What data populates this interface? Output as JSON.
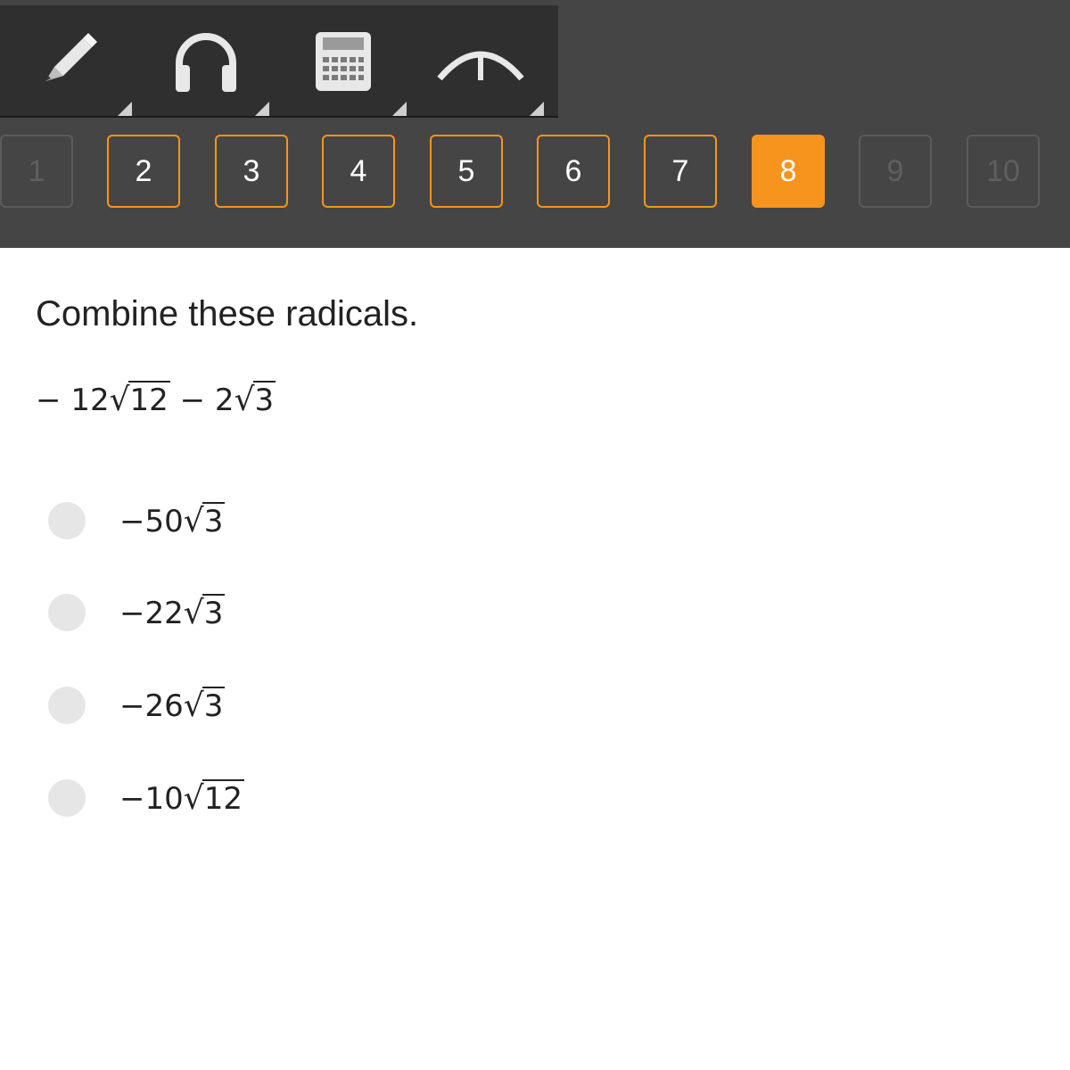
{
  "toolbar": {
    "tools": [
      {
        "name": "pencil-icon"
      },
      {
        "name": "headphones-icon"
      },
      {
        "name": "calculator-icon"
      },
      {
        "name": "graph-icon"
      }
    ]
  },
  "question_nav": {
    "items": [
      {
        "label": "1",
        "state": "disabled"
      },
      {
        "label": "2",
        "state": "visited"
      },
      {
        "label": "3",
        "state": "visited"
      },
      {
        "label": "4",
        "state": "visited"
      },
      {
        "label": "5",
        "state": "visited"
      },
      {
        "label": "6",
        "state": "visited"
      },
      {
        "label": "7",
        "state": "visited"
      },
      {
        "label": "8",
        "state": "current"
      },
      {
        "label": "9",
        "state": "disabled"
      },
      {
        "label": "10",
        "state": "disabled"
      }
    ]
  },
  "question": {
    "prompt": "Combine these radicals.",
    "expression": {
      "minus1": "−",
      "coef1": "12",
      "radicand1": "12",
      "minus2": "−",
      "coef2": "2",
      "radicand2": "3"
    }
  },
  "options": [
    {
      "sign": "−",
      "coef": "50",
      "radicand": "3"
    },
    {
      "sign": "−",
      "coef": "22",
      "radicand": "3"
    },
    {
      "sign": "−",
      "coef": "26",
      "radicand": "3"
    },
    {
      "sign": "−",
      "coef": "10",
      "radicand": "12"
    }
  ],
  "colors": {
    "accent": "#f7941d",
    "header_bg": "#454545",
    "toolbar_bg": "#2f2f2f",
    "radio_bg": "#e6e6e6"
  }
}
